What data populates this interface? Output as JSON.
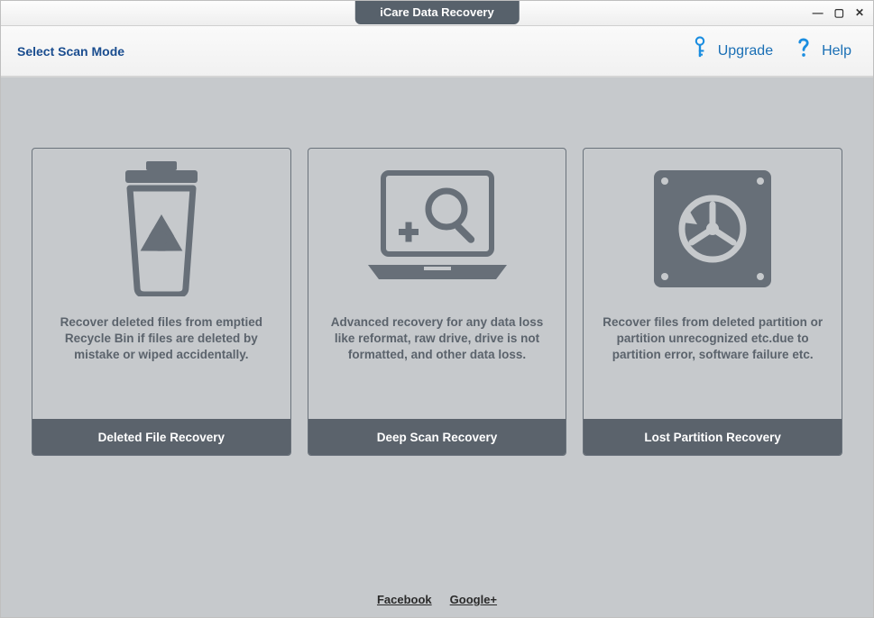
{
  "app": {
    "title": "iCare Data Recovery"
  },
  "toolbar": {
    "mode_label": "Select Scan Mode",
    "upgrade": "Upgrade",
    "help": "Help"
  },
  "cards": [
    {
      "desc": "Recover deleted files from emptied Recycle Bin if files are deleted by mistake or wiped accidentally.",
      "title": "Deleted File Recovery"
    },
    {
      "desc": "Advanced recovery for any data loss like reformat, raw drive, drive is not formatted, and other data loss.",
      "title": "Deep Scan Recovery"
    },
    {
      "desc": "Recover files from deleted partition or partition unrecognized etc.due to partition error, software failure etc.",
      "title": "Lost Partition Recovery"
    }
  ],
  "footer_links": {
    "facebook": "Facebook",
    "googleplus": "Google+"
  }
}
